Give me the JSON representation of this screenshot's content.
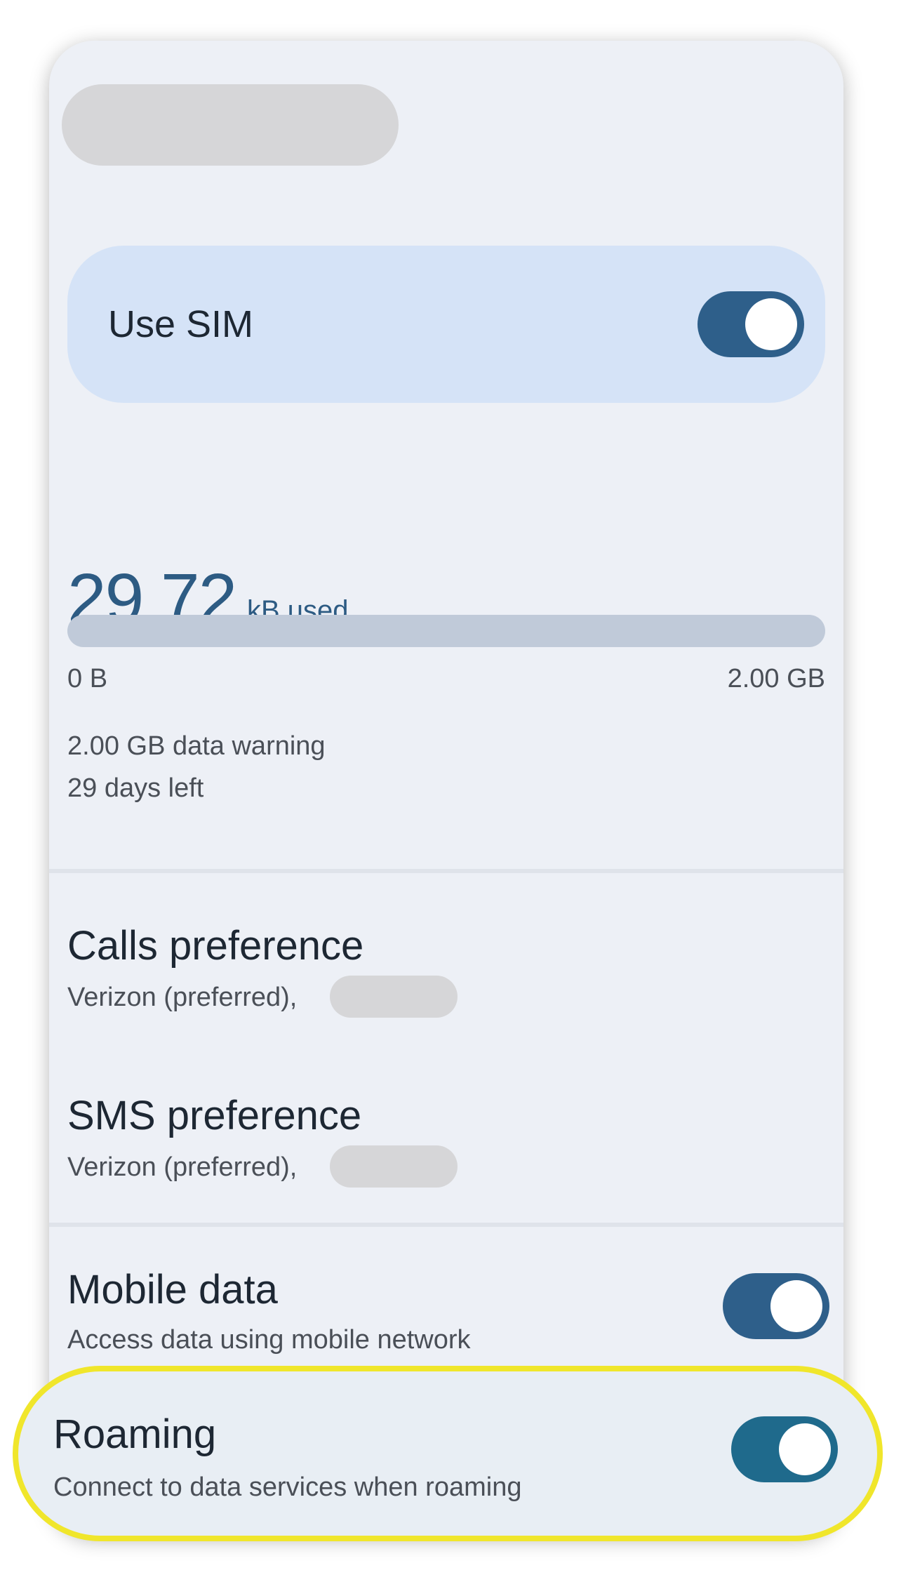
{
  "sim": {
    "label": "Use SIM",
    "enabled": true
  },
  "usage": {
    "value": "29.72",
    "unit": "kB used",
    "bar_fill_fraction": 0.0,
    "min_label": "0 B",
    "max_label": "2.00 GB",
    "warning": "2.00 GB data warning",
    "days_left": "29 days left"
  },
  "calls": {
    "title": "Calls preference",
    "subtitle": "Verizon (preferred),"
  },
  "sms": {
    "title": "SMS preference",
    "subtitle": "Verizon (preferred),"
  },
  "mobile_data": {
    "title": "Mobile data",
    "subtitle": "Access data using mobile network",
    "enabled": true
  },
  "roaming": {
    "title": "Roaming",
    "subtitle": "Connect to data services when roaming",
    "enabled": true
  },
  "colors": {
    "accent": "#2d5b83",
    "highlight": "#f0e62b",
    "card_bg": "#edf0f6",
    "sim_bg": "#d5e3f7"
  }
}
